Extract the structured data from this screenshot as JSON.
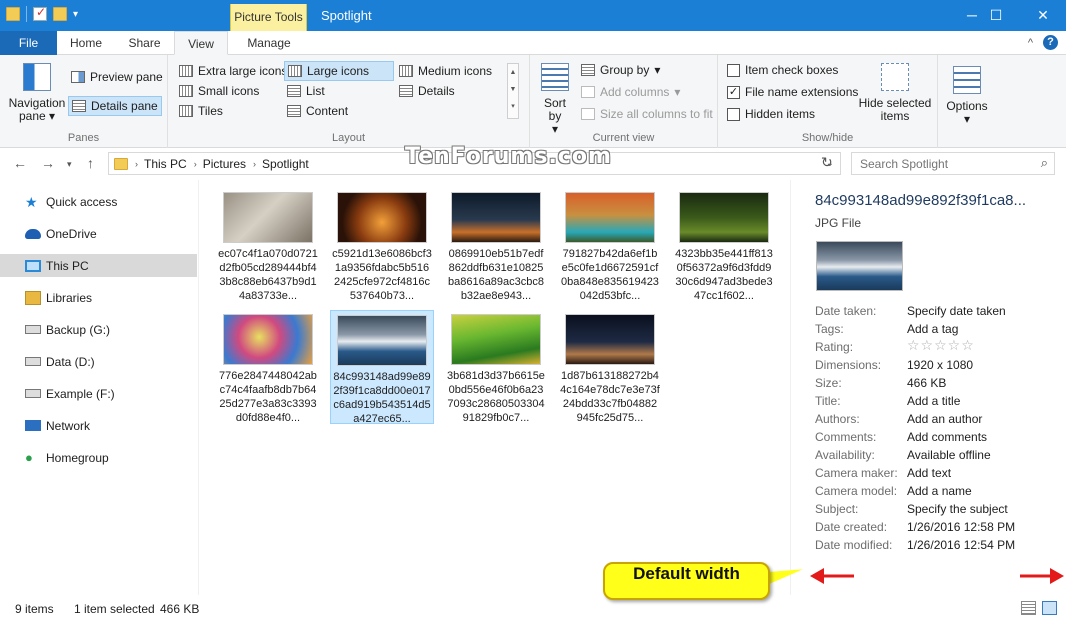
{
  "window": {
    "title": "Spotlight",
    "context_tab_group": "Picture Tools",
    "controls": [
      "minimize",
      "maximize",
      "close"
    ]
  },
  "ribbon_tabs": [
    "File",
    "Home",
    "Share",
    "View",
    "Manage"
  ],
  "active_tab": "View",
  "ribbon": {
    "panes": {
      "label": "Panes",
      "navigation_pane": "Navigation pane",
      "preview_pane": "Preview pane",
      "details_pane": "Details pane"
    },
    "layout": {
      "label": "Layout",
      "options": [
        "Extra large icons",
        "Large icons",
        "Medium icons",
        "Small icons",
        "List",
        "Details",
        "Tiles",
        "Content"
      ],
      "selected": "Large icons"
    },
    "current_view": {
      "label": "Current view",
      "sort_by": "Sort by",
      "group_by": "Group by",
      "add_columns": "Add columns",
      "size_all_columns": "Size all columns to fit"
    },
    "show_hide": {
      "label": "Show/hide",
      "item_check_boxes": "Item check boxes",
      "item_check_boxes_checked": false,
      "file_name_extensions": "File name extensions",
      "file_name_extensions_checked": true,
      "hidden_items": "Hidden items",
      "hidden_items_checked": false,
      "hide_selected_items": "Hide selected items"
    },
    "options": "Options"
  },
  "address": {
    "breadcrumb": [
      "This PC",
      "Pictures",
      "Spotlight"
    ],
    "search_placeholder": "Search Spotlight"
  },
  "watermark": "TenForums.com",
  "nav_pane": [
    {
      "label": "Quick access",
      "icon": "star-icon",
      "color": "#1a7fd5"
    },
    {
      "label": "OneDrive",
      "icon": "cloud-icon",
      "color": "#1e5fb4"
    },
    {
      "label": "This PC",
      "icon": "monitor-icon",
      "color": "#2a8ad8",
      "selected": true
    },
    {
      "label": "Libraries",
      "icon": "library-icon",
      "color": "#e9b840"
    },
    {
      "label": "Backup (G:)",
      "icon": "drive-icon",
      "color": "#777777"
    },
    {
      "label": "Data (D:)",
      "icon": "drive-icon",
      "color": "#777777"
    },
    {
      "label": "Example (F:)",
      "icon": "drive-icon",
      "color": "#777777"
    },
    {
      "label": "Network",
      "icon": "network-icon",
      "color": "#2a6fc0"
    },
    {
      "label": "Homegroup",
      "icon": "homegroup-icon",
      "color": "#2aa04a"
    }
  ],
  "files": [
    {
      "name": "ec07c4f1a070d0721d2fb05cd289444bf43b8c88eb6437b9d14a83733e...",
      "fill": "linear-gradient(135deg,#9a9185,#d6d0c4 45%,#7c7266)"
    },
    {
      "name": "c5921d13e6086bcf31a9356fdabc5b5162425cfe972cf4816c537640b73...",
      "fill": "radial-gradient(circle at 50% 60%,#f2a03a,#8a3c10 45%,#2a1208 75%)"
    },
    {
      "name": "0869910eb51b7edf862ddfb631e10825ba8616a89ac3cbc8b32ae8e943...",
      "fill": "linear-gradient(180deg,#0c1a2a,#2a3a4e 55%,#c8702a 80%,#2a1a10)"
    },
    {
      "name": "791827b42da6ef1be5c0fe1d6672591cf0ba848e835619423042d53bfc...",
      "fill": "linear-gradient(180deg,#d8602a,#c99040 45%,#28a8b8 80%,#3a5a2a)"
    },
    {
      "name": "4323bb35e441ff8130f56372a9f6d3fdd930c6d947ad3bede347cc1f602...",
      "fill": "linear-gradient(180deg,#1a2a10,#3a5a1a 50%,#6a8a2a 80%,#1a2a10)"
    },
    {
      "name": "776e2847448042abc74c4faafb8db7b6425d277e3a83c3393d0fd88e4f0...",
      "fill": "radial-gradient(circle at 40% 45%,#e8e060,#d04a80 35%,#3a7ad0 65%,#e8a040)"
    },
    {
      "name": "84c993148ad99e892f39f1ca8dd00e017c6ad919b543514d5a427ec65...",
      "fill": "linear-gradient(180deg,#3a4a5a,#8a98a8 38%,#e8ecf0 52%,#2a5a8a 72%,#1a3a5a)",
      "selected": true
    },
    {
      "name": "3b681d3d37b6615e0bd556e46f0b6a237093c2868050330491829fb0c7...",
      "fill": "linear-gradient(170deg,#c8d040,#6ab830 40%,#2a7a20 75%,#d8b030)"
    },
    {
      "name": "1d87b613188272b44c164e78dc7e3e73f24bdd33c7fb04882945fc25d75...",
      "fill": "linear-gradient(180deg,#0a0f1e,#1e2a44 55%,#b07a4a 80%,#2a1a14)"
    }
  ],
  "details": {
    "name": "84c993148ad99e892f39f1ca8...",
    "type": "JPG File",
    "thumb_fill": "linear-gradient(180deg,#3a4a5a,#8a98a8 38%,#e8ecf0 52%,#2a5a8a 72%,#1a3a5a)",
    "rating_stars": "☆☆☆☆☆",
    "rows": [
      {
        "label": "Date taken:",
        "value": "Specify date taken"
      },
      {
        "label": "Tags:",
        "value": "Add a tag"
      },
      {
        "label": "Rating:",
        "value": ""
      },
      {
        "label": "Dimensions:",
        "value": "1920 x 1080"
      },
      {
        "label": "Size:",
        "value": "466 KB"
      },
      {
        "label": "Title:",
        "value": "Add a title"
      },
      {
        "label": "Authors:",
        "value": "Add an author"
      },
      {
        "label": "Comments:",
        "value": "Add comments"
      },
      {
        "label": "Availability:",
        "value": "Available offline"
      },
      {
        "label": "Camera maker:",
        "value": "Add text"
      },
      {
        "label": "Camera model:",
        "value": "Add a name"
      },
      {
        "label": "Subject:",
        "value": "Specify the subject"
      },
      {
        "label": "Date created:",
        "value": "1/26/2016 12:58 PM"
      },
      {
        "label": "Date modified:",
        "value": "1/26/2016 12:54 PM"
      }
    ]
  },
  "status": {
    "items_count": "9 items",
    "selection": "1 item selected",
    "selection_size": "466 KB"
  },
  "callout": "Default width",
  "colors": {
    "titlebar": "#1a7fd5",
    "selection": "#cce8ff",
    "callout": "#ffff1a",
    "arrow": "#e21a1a"
  }
}
